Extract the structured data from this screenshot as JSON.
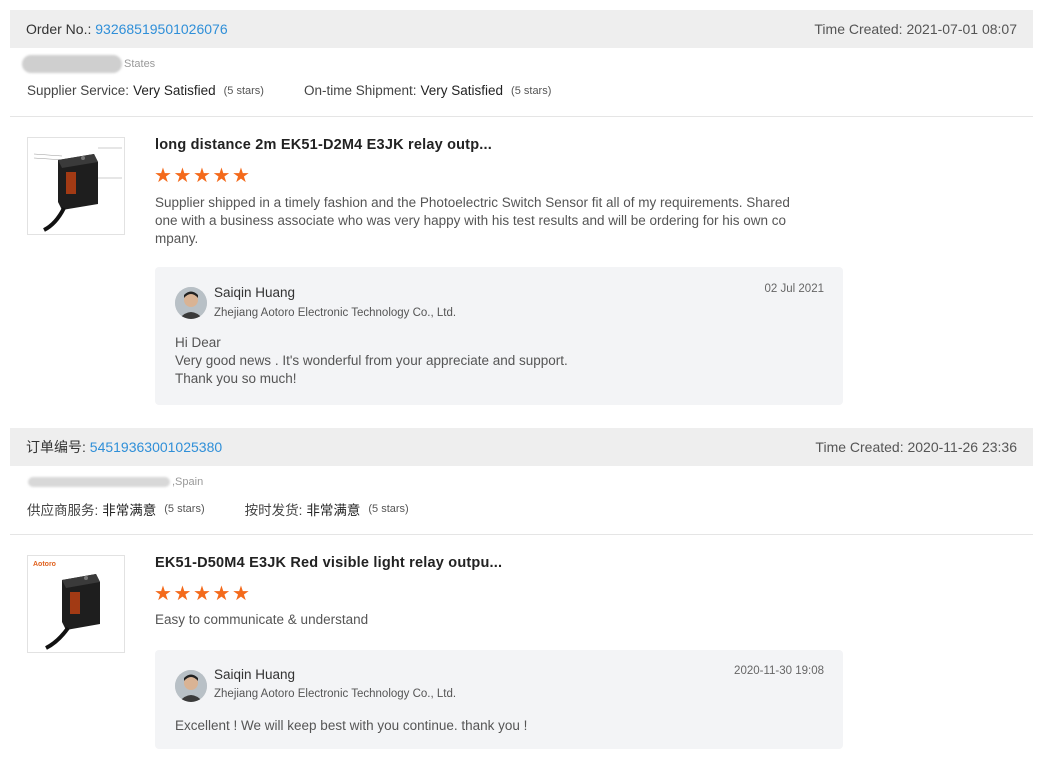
{
  "reviews": [
    {
      "order_label": "Order No.:",
      "order_no": "93268519501026076",
      "time_created": "Time Created: 2021-07-01 08:07",
      "country": "States",
      "supplier_service_label": "Supplier Service:",
      "supplier_service_value": "Very Satisfied",
      "supplier_service_stars": "(5 stars)",
      "shipment_label": "On-time Shipment:",
      "shipment_value": "Very Satisfied",
      "shipment_stars": "(5 stars)",
      "product_title": "long distance 2m EK51-D2M4 E3JK relay outp...",
      "rating": 5,
      "comment": "Supplier shipped in a timely fashion and the Photoelectric Switch Sensor fit all of my requirements.  Shared one with a business associate who was very happy with his test results and will be ordering for his own co mpany.",
      "reply": {
        "seller_name": "Saiqin Huang",
        "company": "Zhejiang Aotoro Electronic Technology Co., Ltd.",
        "date": "02 Jul 2021",
        "lines": [
          "Hi Dear",
          "Very good news . It's wonderful from your appreciate and support.",
          "Thank you so much!"
        ]
      }
    },
    {
      "order_label": "订单编号:",
      "order_no": "54519363001025380",
      "time_created": "Time Created: 2020-11-26 23:36",
      "country": ",Spain",
      "supplier_service_label": "供应商服务:",
      "supplier_service_value": "非常满意",
      "supplier_service_stars": "(5 stars)",
      "shipment_label": "按时发货:",
      "shipment_value": "非常满意",
      "shipment_stars": "(5 stars)",
      "product_title": "EK51-D50M4 E3JK Red visible light relay outpu...",
      "brand": "Aotoro",
      "rating": 5,
      "comment": "Easy to communicate & understand",
      "reply": {
        "seller_name": "Saiqin Huang",
        "company": "Zhejiang Aotoro Electronic Technology Co., Ltd.",
        "date": "2020-11-30 19:08",
        "lines": [
          "Excellent ! We will keep best with you continue. thank you !"
        ]
      }
    }
  ],
  "colors": {
    "accent_link": "#2f8fd8",
    "star": "#f46a1b",
    "bar_bg": "#eeeeee",
    "reply_bg": "#f3f4f6"
  }
}
